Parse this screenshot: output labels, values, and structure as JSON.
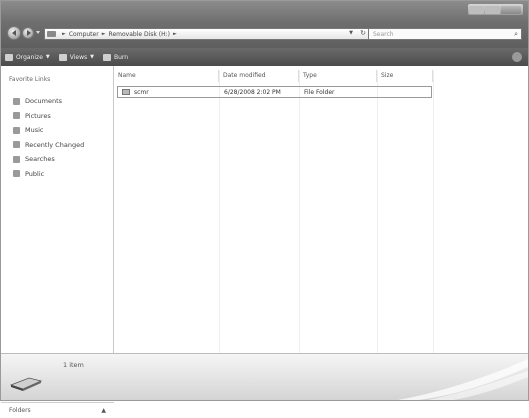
{
  "window": {
    "controls": [
      "minimize",
      "maximize",
      "close"
    ]
  },
  "address": {
    "crumbs": [
      "Computer",
      "Removable Disk (H:)"
    ],
    "search_placeholder": "Search"
  },
  "toolbar": {
    "organize_label": "Organize",
    "views_label": "Views",
    "burn_label": "Burn"
  },
  "nav_pane": {
    "heading": "Favorite Links",
    "items": [
      {
        "label": "Documents",
        "icon": "documents-icon"
      },
      {
        "label": "Pictures",
        "icon": "pictures-icon"
      },
      {
        "label": "Music",
        "icon": "music-icon"
      },
      {
        "label": "Recently Changed",
        "icon": "recently-changed-icon"
      },
      {
        "label": "Searches",
        "icon": "searches-icon"
      },
      {
        "label": "Public",
        "icon": "public-icon"
      }
    ],
    "folders_label": "Folders"
  },
  "columns": {
    "name": "Name",
    "date": "Date modified",
    "type": "Type",
    "size": "Size"
  },
  "files": [
    {
      "name": "scmr",
      "date": "6/28/2008 2:02 PM",
      "type": "File Folder",
      "size": ""
    }
  ],
  "details": {
    "item_count": "1 item"
  }
}
